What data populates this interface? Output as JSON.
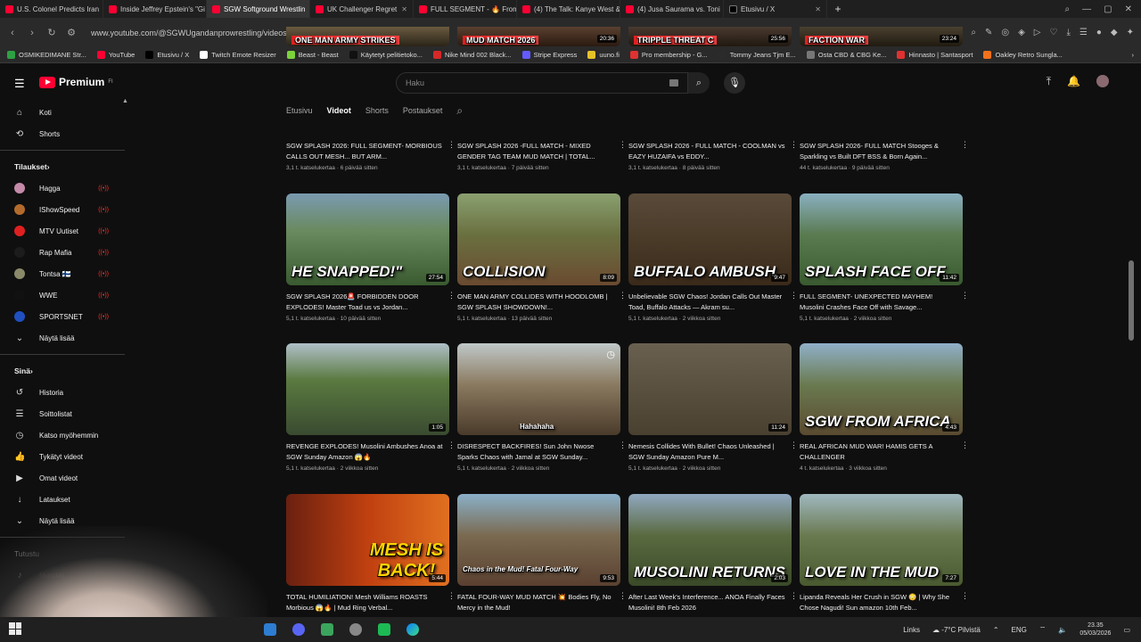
{
  "browser": {
    "tabs": [
      {
        "title": "U.S. Colonel Predicts Iran",
        "fav": "yt"
      },
      {
        "title": "Inside Jeffrey Epstein's \"Gi",
        "fav": "yt"
      },
      {
        "title": "SGW Softground Wrestlin",
        "fav": "yt",
        "active": true
      },
      {
        "title": "UK Challenger Regret",
        "fav": "yt"
      },
      {
        "title": "FULL SEGMENT - 🔥 From",
        "fav": "yt"
      },
      {
        "title": "(4) The Talk: Kanye West &",
        "fav": "yt"
      },
      {
        "title": "(4) Jusa Saurama vs. Toni",
        "fav": "yt"
      },
      {
        "title": "Etusivu / X",
        "fav": "x"
      }
    ],
    "new_tab": "+",
    "url": "www.youtube.com/@SGWUgandanprowrestling/videos",
    "bookmarks": [
      {
        "label": "OSMIKEDIMANE Str...",
        "color": "#2ea043"
      },
      {
        "label": "YouTube",
        "color": "#ff0033"
      },
      {
        "label": "Etusivu / X",
        "color": "#000000"
      },
      {
        "label": "Twitch Emote Resizer",
        "color": "#ffffff"
      },
      {
        "label": "Beast - Beast",
        "color": "#7cd23b"
      },
      {
        "label": "Käytetyt pelitietoko...",
        "color": "#111111"
      },
      {
        "label": "Nike Mind 002 Black...",
        "color": "#d62828"
      },
      {
        "label": "Stripe Express",
        "color": "#635bff"
      },
      {
        "label": "uuno.fi",
        "color": "#e6c229"
      },
      {
        "label": "Pro membership - G...",
        "color": "#e03131"
      },
      {
        "label": "Tommy Jeans Tjm E...",
        "color": "#2b2b2b"
      },
      {
        "label": "Osta CBD & CBG Ke...",
        "color": "#777777"
      },
      {
        "label": "Hinnasto | Santasport",
        "color": "#e03131"
      },
      {
        "label": "Oakley Retro Sungla...",
        "color": "#f2711c"
      }
    ]
  },
  "yt": {
    "logo_text": "Premium",
    "logo_sup": "FI",
    "search_placeholder": "Haku",
    "nav": [
      {
        "label": "Koti",
        "icon": "home-icon",
        "glyph": "⌂"
      },
      {
        "label": "Shorts",
        "icon": "shorts-icon",
        "glyph": "⟲"
      }
    ],
    "subs_title": "Tilaukset",
    "subs": [
      {
        "label": "Hagga",
        "color": "#c48aa8"
      },
      {
        "label": "IShowSpeed",
        "color": "#b36b2c"
      },
      {
        "label": "MTV Uutiset",
        "color": "#e02020"
      },
      {
        "label": "Rap Mafia",
        "color": "#1c1c1c"
      },
      {
        "label": "Tontsa 🇫🇮",
        "color": "#8a8a6a"
      },
      {
        "label": "WWE",
        "color": "#111111"
      },
      {
        "label": "SPORTSNET",
        "color": "#2050c0"
      }
    ],
    "show_more": "Näytä lisää",
    "you_title": "Sinä",
    "you": [
      {
        "label": "Historia",
        "icon": "history-icon",
        "glyph": "↺"
      },
      {
        "label": "Soittolistat",
        "icon": "playlist-icon",
        "glyph": "☰"
      },
      {
        "label": "Katso myöhemmin",
        "icon": "watch-later-icon",
        "glyph": "◷"
      },
      {
        "label": "Tykätyt videot",
        "icon": "like-icon",
        "glyph": "👍"
      },
      {
        "label": "Omat videot",
        "icon": "your-videos-icon",
        "glyph": "▶"
      },
      {
        "label": "Lataukset",
        "icon": "download-icon",
        "glyph": "↓"
      }
    ],
    "show_more2": "Näytä lisää",
    "explore_title": "Tutustu",
    "explore_item": "Musiikki",
    "channel_tabs": [
      "Etusivu",
      "Videot",
      "Shorts",
      "Postaukset"
    ]
  },
  "videos": [
    {
      "title": "SGW SPLASH 2026: FULL SEGMENT- MORBIOUS CALLS OUT MESH... BUT ARM...",
      "stats": "3,1 t. katselukertaa · 6 päivää sitten",
      "overlay": "ONE MAN ARMY STRIKES",
      "dur": "",
      "bg": "linear-gradient(#6a5a40,#2a2418)"
    },
    {
      "title": "SGW SPLASH 2026 -FULL MATCH - MIXED GENDER TAG TEAM MUD MATCH | TOTAL...",
      "stats": "3,1 t. katselukertaa · 7 päivää sitten",
      "overlay": "MUD MATCH 2026",
      "dur": "20:36",
      "bg": "linear-gradient(#5a4030,#2a1a10)"
    },
    {
      "title": "SGW SPLASH 2026 - FULL MATCH - COOLMAN vs EAZY HUZAIFA vs EDDY...",
      "stats": "3,1 t. katselukertaa · 8 päivää sitten",
      "overlay": "TRIPPLE THREAT C",
      "dur": "25:56",
      "bg": "linear-gradient(#4a3a30,#201810)"
    },
    {
      "title": "SGW SPLASH 2026- FULL MATCH Stooges & Sparkling vs Built DFT BSS & Born Again...",
      "stats": "44 t. katselukertaa · 9 päivää sitten",
      "overlay": "FACTION WAR",
      "dur": "23:24",
      "bg": "linear-gradient(#4a4030,#201a10)"
    },
    {
      "title": "SGW SPLASH 2026🚨 FORBIDDEN DOOR EXPLODES! Master Toad us vs Jordan...",
      "stats": "5,1 t. katselukertaa · 10 päivää sitten",
      "overlay": "HE SNAPPED!\"",
      "dur": "27:54",
      "bg": "linear-gradient(#7a9ab0 0%,#6a8a60 40%,#3a5a30 100%)"
    },
    {
      "title": "ONE MAN ARMY COLLIDES WITH HOODLOMB | SGW SPLASH SHOWDOWN!...",
      "stats": "5,1 t. katselukertaa · 13 päivää sitten",
      "overlay": "COLLISION",
      "dur": "8:09",
      "bg": "linear-gradient(#8aa070 0%,#6a7040 45%,#6a4a30 100%)"
    },
    {
      "title": "Unbelievable SGW Chaos! Jordan Calls Out Master Toad, Buffalo Attacks — Akram su...",
      "stats": "5,1 t. katselukertaa · 2 viikkoa sitten",
      "overlay": "BUFFALO AMBUSH",
      "dur": "9:47",
      "bg": "linear-gradient(#5a4a3a 0%,#4a3a28 50%,#3a2a1a 100%)"
    },
    {
      "title": "FULL SEGMENT- UNEXPECTED MAYHEM! Musolini Crashes Face Off with Savage...",
      "stats": "5,1 t. katselukertaa · 2 viikkoa sitten",
      "overlay": "SPLASH FACE OFF",
      "dur": "11:42",
      "bg": "linear-gradient(#8ab0c0 0%,#5a7a50 45%,#3a5a30 100%)"
    },
    {
      "title": "REVENGE EXPLODES! Musolini Ambushes Anoa at SGW Sunday Amazon 😱🔥",
      "stats": "5,1 t. katselukertaa · 2 viikkoa sitten",
      "overlay": "",
      "dur": "1:05",
      "bg": "linear-gradient(#b0c0c8 0%,#5a7a40 40%,#3a4a30 100%)"
    },
    {
      "title": "DISRESPECT BACKFIRES! Sun John Nwose Sparks Chaos with Jamal at SGW Sunday...",
      "stats": "5,1 t. katselukertaa · 2 viikkoa sitten",
      "overlay": "Hahahaha",
      "dur": "",
      "bg": "linear-gradient(#c0c8c8 0%,#8a7a60 45%,#4a3a2a 100%)"
    },
    {
      "title": "Nemesis Collides With Bullet! Chaos Unleashed | SGW Sunday Amazon Pure M...",
      "stats": "5,1 t. katselukertaa · 2 viikkoa sitten",
      "overlay": "",
      "dur": "11:24",
      "bg": "linear-gradient(#6a6050 0%,#5a5040 50%,#4a4030 100%)"
    },
    {
      "title": "REAL AFRICAN MUD WAR! HAMIS GETS A CHALLENGER",
      "stats": "4 t. katselukertaa · 3 viikkoa sitten",
      "overlay": "SGW FROM AFRICA",
      "dur": "4:43",
      "bg": "linear-gradient(#90b0c8 0%,#6a7a50 45%,#5a4a30 100%)"
    },
    {
      "title": "TOTAL HUMILIATION! Mesh Williams ROASTS Morbious 😱🔥 | Mud Ring Verbal...",
      "stats": "",
      "overlay": "MESH IS BACK!",
      "dur": "5:44",
      "bg": "linear-gradient(90deg,#6a2010 0%,#c04010 50%,#e07020 100%)"
    },
    {
      "title": "FATAL FOUR-WAY MUD MATCH 💥 Bodies Fly, No Mercy in the Mud!",
      "stats": "",
      "overlay": "Chaos in the Mud! Fatal Four-Way",
      "dur": "9:53",
      "bg": "linear-gradient(#8ab0c8 0%,#7a6a50 45%,#5a4030 100%)"
    },
    {
      "title": "After Last Week's Interference... ANOA Finally Faces Musolini! 8th Feb 2026",
      "stats": "",
      "overlay": "MUSOLINI RETURNS",
      "dur": "2:03",
      "bg": "linear-gradient(#90a8c0 0%,#5a6a40 45%,#3a4a28 100%)"
    },
    {
      "title": "Lipanda Reveals Her Crush in SGW 😳 | Why She Chose Nagudi! Sun amazon 10th Feb...",
      "stats": "",
      "overlay": "LOVE IN THE MUD",
      "dur": "7:27",
      "bg": "linear-gradient(#a0b8c0 0%,#6a7a50 45%,#4a5a30 100%)"
    }
  ],
  "taskbar": {
    "links": "Links",
    "weather": "-7°C Pilvistä",
    "lang": "ENG",
    "time": "23.35",
    "date": "05/03/2026"
  }
}
